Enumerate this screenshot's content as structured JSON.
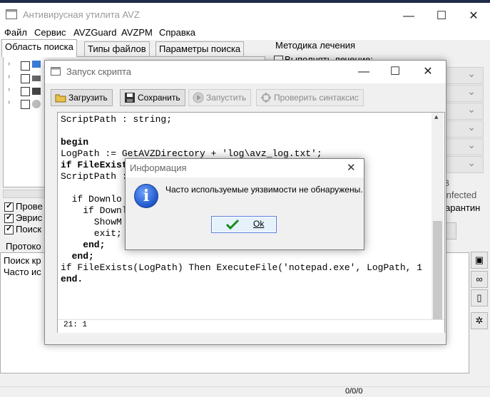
{
  "main_window": {
    "title": "Антивирусная утилита AVZ",
    "controls": {
      "minimize": "—",
      "maximize": "☐",
      "close": "✕"
    }
  },
  "menu": [
    "Файл",
    "Сервис",
    "AVZGuard",
    "AVZPM",
    "Справка"
  ],
  "tabs": [
    "Область поиска",
    "Типы файлов",
    "Параметры поиска"
  ],
  "treatment": {
    "title": "Методика лечения",
    "perform_checkbox": "Выполнять лечение:",
    "right_fragments": [
      "B",
      "Infected",
      "арантин"
    ]
  },
  "options": {
    "items": [
      {
        "label": "Прове",
        "checked": true
      },
      {
        "label": "Эврис",
        "checked": true
      },
      {
        "label": "Поиск",
        "checked": true
      }
    ]
  },
  "log": {
    "title": "Протоко",
    "lines": [
      "Поиск кр",
      "Часто ис"
    ]
  },
  "statusbar": {
    "counter": "0/0/0"
  },
  "script_window": {
    "title": "Запуск скрипта",
    "buttons": {
      "load": "Загрузить",
      "save": "Сохранить",
      "run": "Запустить",
      "check_syntax": "Проверить синтаксис"
    },
    "code_lines": [
      "ScriptPath : string;",
      "",
      "begin",
      "LogPath := GetAVZDirectory + 'log\\avz_log.txt';",
      "if FileExist",
      "ScriptPath :",
      "",
      "  if Downlo                        .txt', Script",
      "    if Downl                       n.txt', Scri",
      "      ShowM                        ля обнаружен",
      "      exit;",
      "    end;",
      "  end;",
      "if FileExists(LogPath) Then ExecuteFile('notepad.exe', LogPath, 1",
      "end."
    ],
    "cursor_position": "21: 1"
  },
  "dialog": {
    "title": "Информация",
    "message": "Часто используемые уязвимости не обнаружены.",
    "ok_label": "Ok",
    "close": "✕"
  }
}
